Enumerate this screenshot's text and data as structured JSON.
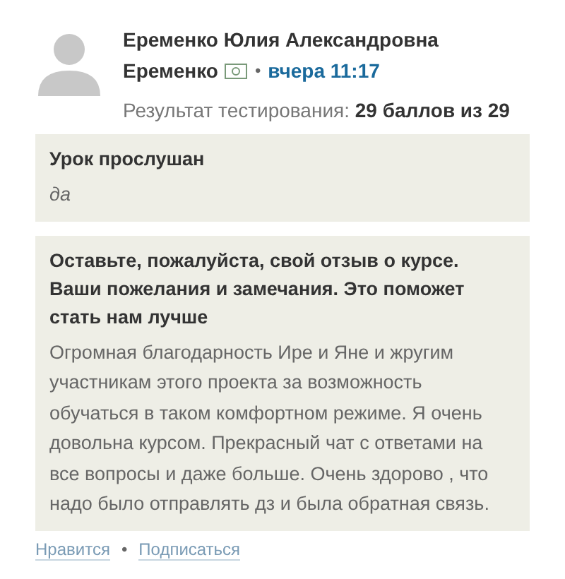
{
  "author": {
    "full_name": "Еременко Юлия Александровна",
    "short_name": "Еременко",
    "separator": "•",
    "time": "вчера 11:17",
    "result": "Результат тестирования: **29 баллов из 29**"
  },
  "answers": [
    {
      "question": "Урок прослушан",
      "answer": "да",
      "italic": true
    },
    {
      "question": "Оставьте, пожалуйста, свой отзыв о курсе. Ваши пожелания и замечания. Это поможет стать нам лучше",
      "answer": "Огромная благодарность Ире и Яне и жругим участникам этого проекта за возможность обучаться в таком комфортном режиме. Я очень довольна курсом. Прекрасный чат с ответами на все вопросы и даже больше. Очень здорово , что надо было отправлять дз и была обратная связь.",
      "italic": false
    }
  ],
  "actions": [
    {
      "label": "Нравится"
    },
    {
      "label": "Подписаться"
    }
  ],
  "actions_separator": "•"
}
